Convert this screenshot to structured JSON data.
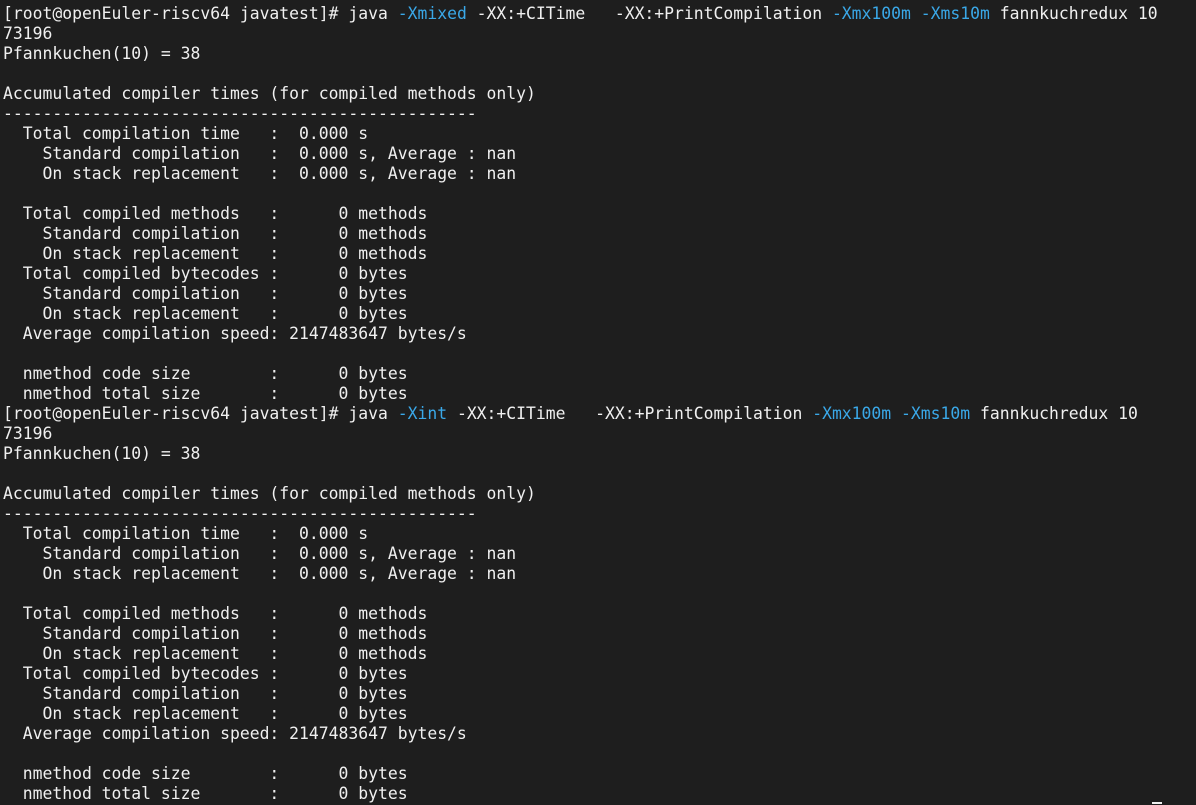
{
  "terminal": {
    "lines": [
      [
        {
          "t": "[root@openEuler-riscv64 javatest]# java ",
          "c": "normal"
        },
        {
          "t": "-Xmixed",
          "c": "option"
        },
        {
          "t": " -XX:+CITime   -XX:+PrintCompilation ",
          "c": "normal"
        },
        {
          "t": "-Xmx100m",
          "c": "option"
        },
        {
          "t": " ",
          "c": "normal"
        },
        {
          "t": "-Xms10m",
          "c": "option"
        },
        {
          "t": " fannkuchredux 10",
          "c": "normal"
        }
      ],
      [
        {
          "t": "73196",
          "c": "normal"
        }
      ],
      [
        {
          "t": "Pfannkuchen(10) = 38",
          "c": "normal"
        }
      ],
      [
        {
          "t": "",
          "c": "normal"
        }
      ],
      [
        {
          "t": "Accumulated compiler times (for compiled methods only)",
          "c": "normal"
        }
      ],
      [
        {
          "t": "------------------------------------------------",
          "c": "normal"
        }
      ],
      [
        {
          "t": "  Total compilation time   :  0.000 s",
          "c": "normal"
        }
      ],
      [
        {
          "t": "    Standard compilation   :  0.000 s, Average : nan",
          "c": "normal"
        }
      ],
      [
        {
          "t": "    On stack replacement   :  0.000 s, Average : nan",
          "c": "normal"
        }
      ],
      [
        {
          "t": "",
          "c": "normal"
        }
      ],
      [
        {
          "t": "  Total compiled methods   :      0 methods",
          "c": "normal"
        }
      ],
      [
        {
          "t": "    Standard compilation   :      0 methods",
          "c": "normal"
        }
      ],
      [
        {
          "t": "    On stack replacement   :      0 methods",
          "c": "normal"
        }
      ],
      [
        {
          "t": "  Total compiled bytecodes :      0 bytes",
          "c": "normal"
        }
      ],
      [
        {
          "t": "    Standard compilation   :      0 bytes",
          "c": "normal"
        }
      ],
      [
        {
          "t": "    On stack replacement   :      0 bytes",
          "c": "normal"
        }
      ],
      [
        {
          "t": "  Average compilation speed: 2147483647 bytes/s",
          "c": "normal"
        }
      ],
      [
        {
          "t": "",
          "c": "normal"
        }
      ],
      [
        {
          "t": "  nmethod code size        :      0 bytes",
          "c": "normal"
        }
      ],
      [
        {
          "t": "  nmethod total size       :      0 bytes",
          "c": "normal"
        }
      ],
      [
        {
          "t": "[root@openEuler-riscv64 javatest]# java ",
          "c": "normal"
        },
        {
          "t": "-Xint",
          "c": "option"
        },
        {
          "t": " -XX:+CITime   -XX:+PrintCompilation ",
          "c": "normal"
        },
        {
          "t": "-Xmx100m",
          "c": "option"
        },
        {
          "t": " ",
          "c": "normal"
        },
        {
          "t": "-Xms10m",
          "c": "option"
        },
        {
          "t": " fannkuchredux 10",
          "c": "normal"
        }
      ],
      [
        {
          "t": "73196",
          "c": "normal"
        }
      ],
      [
        {
          "t": "Pfannkuchen(10) = 38",
          "c": "normal"
        }
      ],
      [
        {
          "t": "",
          "c": "normal"
        }
      ],
      [
        {
          "t": "Accumulated compiler times (for compiled methods only)",
          "c": "normal"
        }
      ],
      [
        {
          "t": "------------------------------------------------",
          "c": "normal"
        }
      ],
      [
        {
          "t": "  Total compilation time   :  0.000 s",
          "c": "normal"
        }
      ],
      [
        {
          "t": "    Standard compilation   :  0.000 s, Average : nan",
          "c": "normal"
        }
      ],
      [
        {
          "t": "    On stack replacement   :  0.000 s, Average : nan",
          "c": "normal"
        }
      ],
      [
        {
          "t": "",
          "c": "normal"
        }
      ],
      [
        {
          "t": "  Total compiled methods   :      0 methods",
          "c": "normal"
        }
      ],
      [
        {
          "t": "    Standard compilation   :      0 methods",
          "c": "normal"
        }
      ],
      [
        {
          "t": "    On stack replacement   :      0 methods",
          "c": "normal"
        }
      ],
      [
        {
          "t": "  Total compiled bytecodes :      0 bytes",
          "c": "normal"
        }
      ],
      [
        {
          "t": "    Standard compilation   :      0 bytes",
          "c": "normal"
        }
      ],
      [
        {
          "t": "    On stack replacement   :      0 bytes",
          "c": "normal"
        }
      ],
      [
        {
          "t": "  Average compilation speed: 2147483647 bytes/s",
          "c": "normal"
        }
      ],
      [
        {
          "t": "",
          "c": "normal"
        }
      ],
      [
        {
          "t": "  nmethod code size        :      0 bytes",
          "c": "normal"
        }
      ],
      [
        {
          "t": "  nmethod total size       :      0 bytes",
          "c": "normal"
        }
      ]
    ]
  },
  "colors": {
    "background": "#1e1e1e",
    "text": "#f0f0f0",
    "option": "#3aa8e8"
  }
}
